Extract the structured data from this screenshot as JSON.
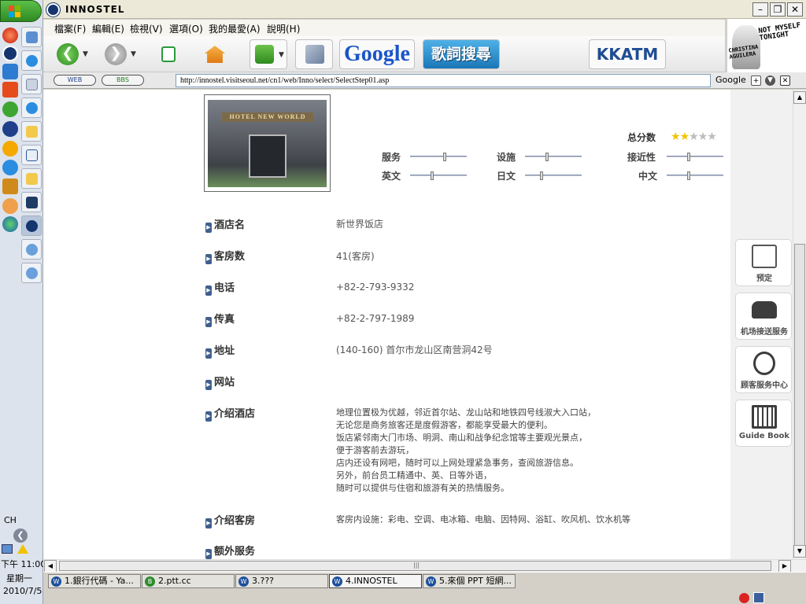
{
  "window": {
    "title": "INNOSTEL"
  },
  "menu": [
    "檔案(F)",
    "編輯(E)",
    "檢視(V)",
    "選項(O)",
    "我的最愛(A)",
    "說明(H)"
  ],
  "toolbar": {
    "google_label": "Google",
    "lyrics_label": "歌詞搜尋",
    "kkatm_label": "KKATM"
  },
  "ad": {
    "line1": "NOT MYSELF TONIGHT",
    "line2": "CHRISTINA AGUILERA"
  },
  "address": {
    "web_label": "WEB",
    "bbs_label": "BBS",
    "url": "http://innostel.visitseoul.net/cn1/web/Inno/select/SelectStep01.asp",
    "search_engine": "Google"
  },
  "photo": {
    "sign": "HOTEL NEW WORLD"
  },
  "rating": {
    "total_label": "总分数",
    "stars": 2,
    "max_stars": 5,
    "items": [
      {
        "label": "服务",
        "value": 0.62
      },
      {
        "label": "设施",
        "value": 0.38
      },
      {
        "label": "接近性",
        "value": 0.38
      },
      {
        "label": "英文",
        "value": 0.38
      },
      {
        "label": "日文",
        "value": 0.28
      },
      {
        "label": "中文",
        "value": 0.38
      }
    ]
  },
  "info": [
    {
      "label": "酒店名",
      "value": "新世界饭店"
    },
    {
      "label": "客房数",
      "value": "41(客房)"
    },
    {
      "label": "电话",
      "value": "+82-2-793-9332"
    },
    {
      "label": "传真",
      "value": "+82-2-797-1989"
    },
    {
      "label": "地址",
      "value": "(140-160) 首尔市龙山区南营洞42号"
    },
    {
      "label": "网站",
      "value": ""
    }
  ],
  "intro": {
    "label": "介绍酒店",
    "lines": [
      "地理位置极为优越，邻近首尔站、龙山站和地铁四号线淑大入口站，",
      "无论您是商务旅客还是度假游客，都能享受最大的便利。",
      "饭店紧邻南大门市场、明洞、南山和战争纪念馆等主要观光景点，",
      "便于游客前去游玩，",
      "店内还设有网吧，随时可以上网处理紧急事务，查阅旅游信息。",
      "另外，前台员工精通中、英、日等外语，",
      "随时可以提供与住宿和旅游有关的热情服务。"
    ]
  },
  "rooms": {
    "label": "介绍客房",
    "value": "客房内设施：彩电、空调、电冰箱、电脑、因特网、浴缸、吹风机、饮水机等"
  },
  "extra": {
    "label": "额外服务"
  },
  "side_buttons": [
    {
      "label": "预定",
      "icon": "calendar-icon"
    },
    {
      "label": "机场接送服务",
      "icon": "car-icon"
    },
    {
      "label": "顾客服务中心",
      "icon": "support-icon"
    },
    {
      "label": "Guide Book",
      "icon": "book-icon"
    }
  ],
  "taskbar": {
    "tasks": [
      "1.銀行代碼 - Ya...",
      "2.ptt.cc",
      "3.???",
      "4.INNOSTEL",
      "5.來個 PPT 短網..."
    ],
    "active_index": 3
  },
  "tray": {
    "lang": "CH",
    "time": "下午 11:00",
    "day": "星期一",
    "date": "2010/7/5"
  }
}
